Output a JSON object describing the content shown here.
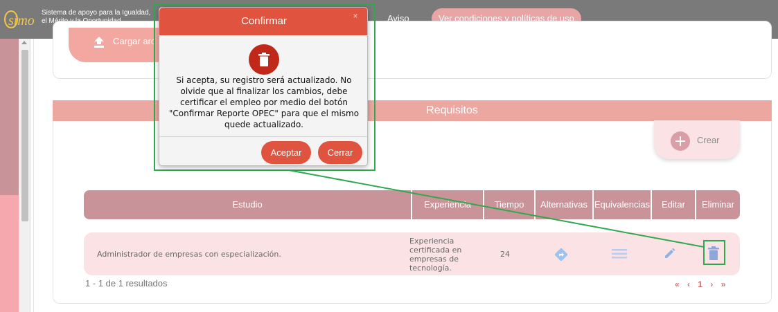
{
  "header": {
    "logo_text": "simo",
    "tagline": "Sistema de apoyo para la Igualdad, el Mérito y la Oportunidad",
    "nav_aviso": "Aviso",
    "nav_terms": "Ver condiciones y políticas de uso"
  },
  "upload": {
    "label": "Cargar arc"
  },
  "requisitos": {
    "title": "Requisitos",
    "crear_label": "Crear",
    "columns": {
      "estudio": "Estudio",
      "experiencia": "Experiencia",
      "tiempo": "Tiempo",
      "alternativas": "Alternativas",
      "equivalencias": "Equivalencias",
      "editar": "Editar",
      "eliminar": "Eliminar"
    },
    "rows": [
      {
        "estudio": "Administrador de empresas con especialización.",
        "experiencia": "Experiencia certificada en empresas de tecnología.",
        "tiempo": "24"
      }
    ],
    "results": "1 - 1 de 1 resultados",
    "pager": {
      "first": "«",
      "prev": "‹",
      "current": "1",
      "next": "›",
      "last": "»"
    }
  },
  "modal": {
    "title": "Confirmar",
    "close": "×",
    "message": "Si acepta, su registro será actualizado. No olvide que al finalizar los cambios, debe certificar el empleo por medio del botón \"Confirmar Reporte OPEC\" para que el mismo quede actualizado.",
    "accept_label": "Aceptar",
    "close_label": "Cerrar"
  },
  "colors": {
    "accent": "#e0533e",
    "table_header": "#c8949a",
    "annotation": "#2fa84f"
  }
}
